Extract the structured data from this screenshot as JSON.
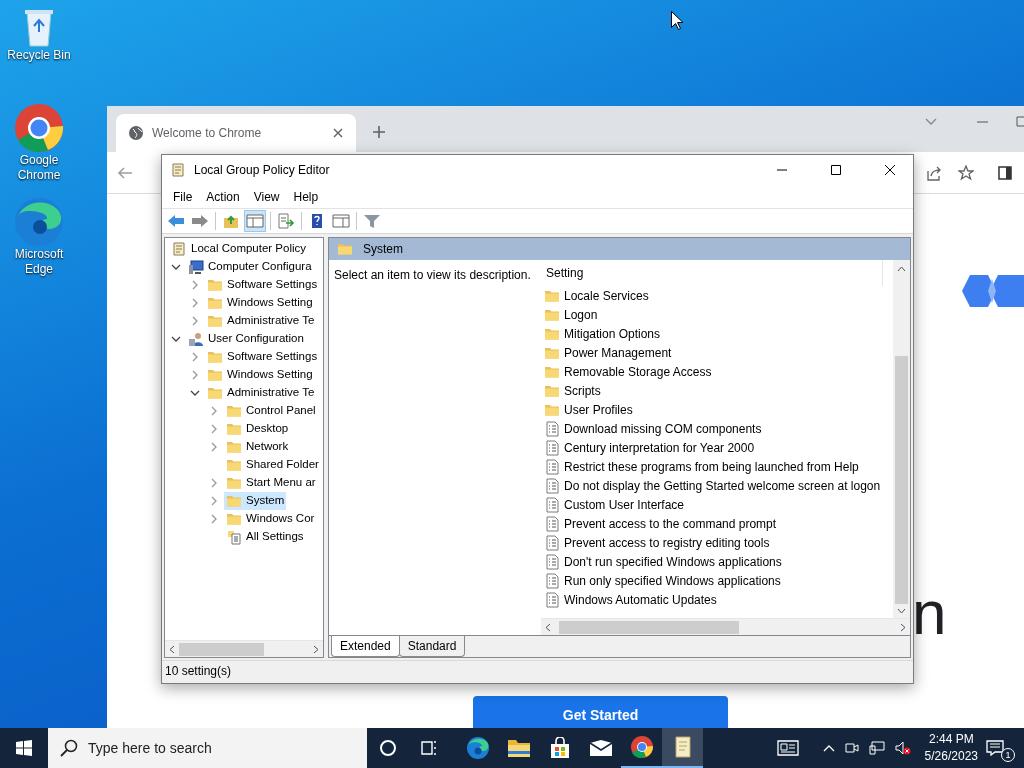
{
  "desktop_icons": [
    {
      "label": "Recycle Bin",
      "kind": "recycle"
    },
    {
      "label": "Google Chrome",
      "kind": "chrome"
    },
    {
      "label": "Microsoft Edge",
      "kind": "edge"
    }
  ],
  "browser": {
    "tabs": [
      {
        "title": "Welcome to Chrome",
        "selected": true
      }
    ],
    "button": "Get Started",
    "heading_fragment": "n"
  },
  "editor": {
    "title": "Local Group Policy Editor",
    "menu": [
      "File",
      "Action",
      "View",
      "Help"
    ],
    "tree": [
      {
        "label": "Local Computer Policy",
        "kind": "policy",
        "selected": false,
        "children": [
          {
            "label": "Computer Configura",
            "kind": "computer",
            "expanded": true,
            "selected": false,
            "children": [
              {
                "label": "Software Settings",
                "kind": "folder",
                "expanded": false,
                "selected": false
              },
              {
                "label": "Windows Setting",
                "kind": "folder",
                "expanded": false,
                "selected": false
              },
              {
                "label": "Administrative Te",
                "kind": "folder",
                "expanded": false,
                "selected": false
              }
            ]
          },
          {
            "label": "User Configuration",
            "kind": "user",
            "expanded": true,
            "selected": false,
            "children": [
              {
                "label": "Software Settings",
                "kind": "folder",
                "expanded": false,
                "selected": false
              },
              {
                "label": "Windows Setting",
                "kind": "folder",
                "expanded": false,
                "selected": false
              },
              {
                "label": "Administrative Te",
                "kind": "folder",
                "expanded": true,
                "selected": false,
                "children": [
                  {
                    "label": "Control Panel",
                    "kind": "folder",
                    "expanded": false,
                    "selected": false
                  },
                  {
                    "label": "Desktop",
                    "kind": "folder",
                    "expanded": false,
                    "selected": false
                  },
                  {
                    "label": "Network",
                    "kind": "folder",
                    "expanded": false,
                    "selected": false
                  },
                  {
                    "label": "Shared Folder",
                    "kind": "folder",
                    "selected": false
                  },
                  {
                    "label": "Start Menu ar",
                    "kind": "folder",
                    "expanded": false,
                    "selected": false
                  },
                  {
                    "label": "System",
                    "kind": "folder",
                    "expanded": false,
                    "selected": true
                  },
                  {
                    "label": "Windows Cor",
                    "kind": "folder",
                    "expanded": false,
                    "selected": false
                  },
                  {
                    "label": "All Settings",
                    "kind": "all-settings",
                    "selected": false
                  }
                ]
              }
            ]
          }
        ]
      }
    ],
    "panel_title": "System",
    "description": "Select an item to view its description.",
    "column": "Setting",
    "settings": [
      {
        "name": "Locale Services",
        "kind": "folder"
      },
      {
        "name": "Logon",
        "kind": "folder"
      },
      {
        "name": "Mitigation Options",
        "kind": "folder"
      },
      {
        "name": "Power Management",
        "kind": "folder"
      },
      {
        "name": "Removable Storage Access",
        "kind": "folder"
      },
      {
        "name": "Scripts",
        "kind": "folder"
      },
      {
        "name": "User Profiles",
        "kind": "folder"
      },
      {
        "name": "Download missing COM components",
        "kind": "policy"
      },
      {
        "name": "Century interpretation for Year 2000",
        "kind": "policy"
      },
      {
        "name": "Restrict these programs from being launched from Help",
        "kind": "policy"
      },
      {
        "name": "Do not display the Getting Started welcome screen at logon",
        "kind": "policy"
      },
      {
        "name": "Custom User Interface",
        "kind": "policy"
      },
      {
        "name": "Prevent access to the command prompt",
        "kind": "policy"
      },
      {
        "name": "Prevent access to registry editing tools",
        "kind": "policy"
      },
      {
        "name": "Don't run specified Windows applications",
        "kind": "policy"
      },
      {
        "name": "Run only specified Windows applications",
        "kind": "policy"
      },
      {
        "name": "Windows Automatic Updates",
        "kind": "policy"
      }
    ],
    "view_tabs": [
      {
        "label": "Extended",
        "selected": true
      },
      {
        "label": "Standard",
        "selected": false
      }
    ],
    "status": "10 setting(s)"
  },
  "taskbar": {
    "search_placeholder": "Type here to search",
    "apps": [
      {
        "kind": "edge",
        "running": false,
        "active": false
      },
      {
        "kind": "explorer",
        "running": false,
        "active": false
      },
      {
        "kind": "store",
        "running": false,
        "active": false
      },
      {
        "kind": "mail",
        "running": false,
        "active": false
      },
      {
        "kind": "chrome",
        "running": true,
        "active": false
      },
      {
        "kind": "policy",
        "running": true,
        "active": true
      }
    ],
    "time": "2:44 PM",
    "date": "5/26/2023",
    "notifications": "1"
  }
}
